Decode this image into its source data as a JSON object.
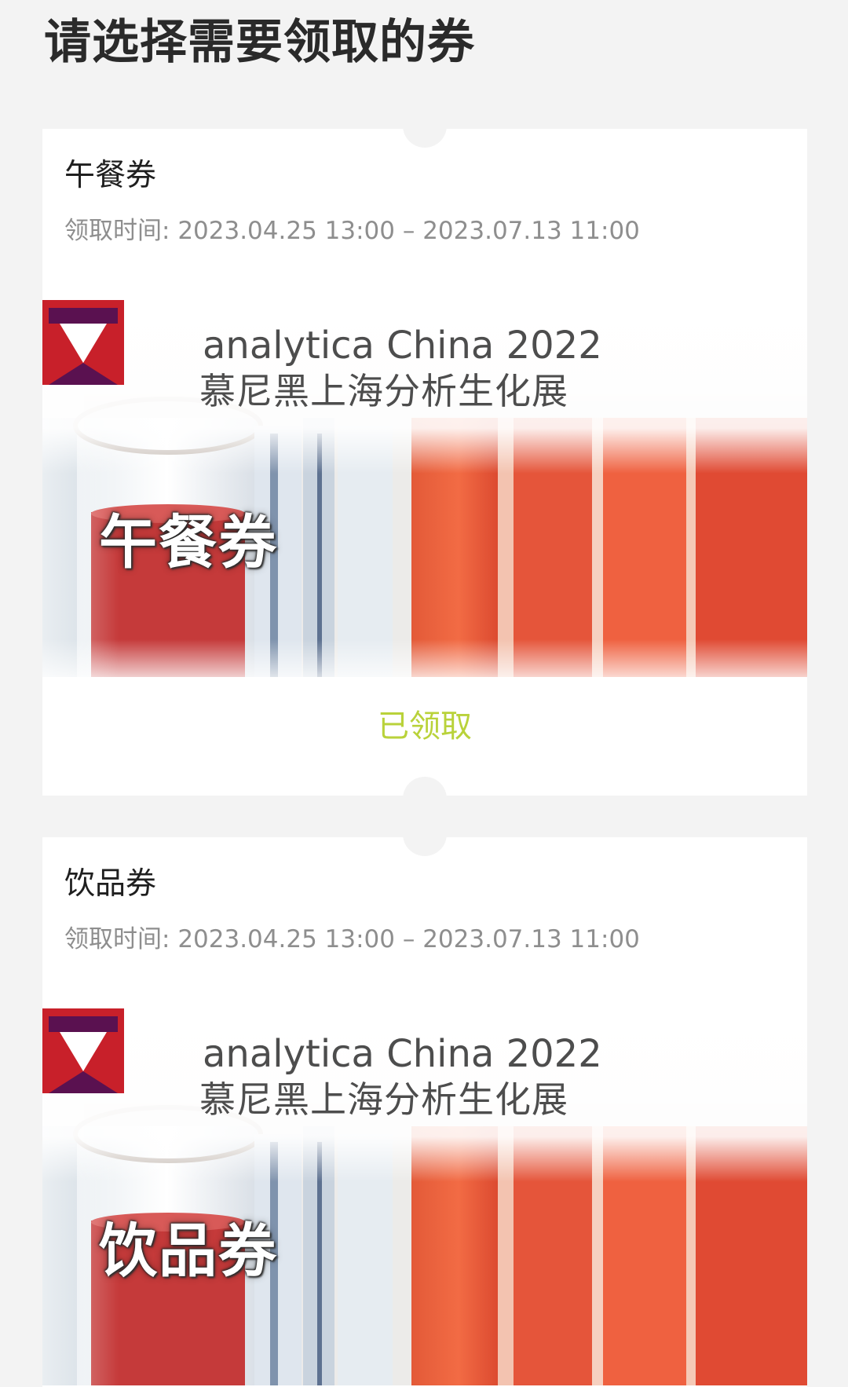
{
  "page": {
    "title": "请选择需要领取的券"
  },
  "banner": {
    "brand_en": "analytica China 2022",
    "brand_cn": "慕尼黑上海分析生化展"
  },
  "coupons": [
    {
      "name": "午餐券",
      "validity_label": "领取时间: ",
      "validity_range": "2023.04.25 13:00 – 2023.07.13 11:00",
      "banner_label": "午餐券",
      "status": "已领取"
    },
    {
      "name": "饮品券",
      "validity_label": "领取时间: ",
      "validity_range": "2023.04.25 13:00 – 2023.07.13 11:00",
      "banner_label": "饮品券"
    }
  ],
  "colors": {
    "page_background": "#f3f3f3",
    "card_background": "#ffffff",
    "status_claimed": "#b9d23a",
    "logo_red": "#c8202a",
    "logo_purple": "#5a1150"
  }
}
